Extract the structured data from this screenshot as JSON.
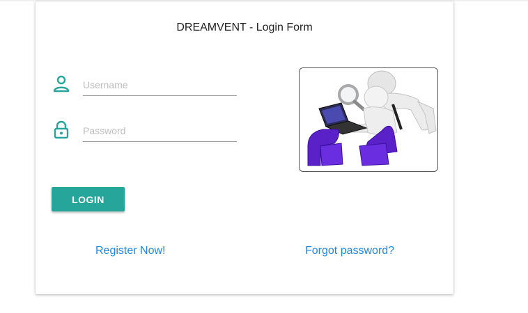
{
  "form": {
    "title": "DREAMVENT - Login Form",
    "username": {
      "placeholder": "Username",
      "value": "",
      "icon": "person-icon"
    },
    "password": {
      "placeholder": "Password",
      "value": "",
      "icon": "lock-icon"
    },
    "login_label": "LOGIN",
    "register_link": "Register Now!",
    "forgot_link": "Forgot password?"
  },
  "illustration": {
    "icon": "person-with-laptop-and-magnifier-illustration"
  },
  "colors": {
    "accent": "#26a69a",
    "link": "#1e88e5",
    "illustration_purple": "#5b21c9"
  }
}
